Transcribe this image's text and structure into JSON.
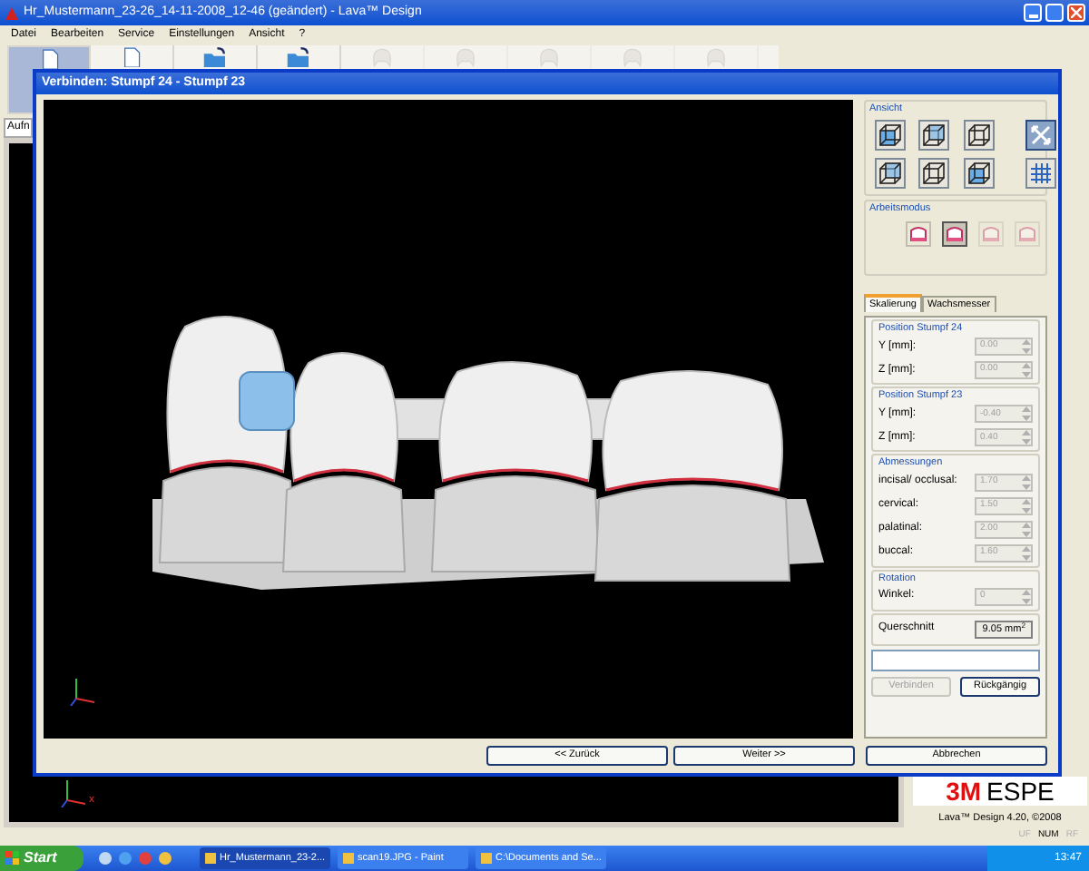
{
  "window": {
    "title": "Hr_Mustermann_23-26_14-11-2008_12-46 (geändert) - Lava™ Design"
  },
  "menu": [
    "Datei",
    "Bearbeiten",
    "Service",
    "Einstellungen",
    "Ansicht",
    "?"
  ],
  "toolbar": [
    {
      "selected": true,
      "disabled": false
    },
    {
      "selected": false,
      "disabled": false
    },
    {
      "selected": false,
      "disabled": false
    },
    {
      "selected": false,
      "disabled": false
    },
    {
      "selected": false,
      "disabled": true
    },
    {
      "selected": false,
      "disabled": true
    },
    {
      "selected": false,
      "disabled": true
    },
    {
      "selected": false,
      "disabled": true
    },
    {
      "selected": false,
      "disabled": true
    }
  ],
  "main_tab": "Aufn",
  "axis_label": "x",
  "brand": {
    "logo_left": "3M",
    "logo_right": "ESPE",
    "version": "Lava™ Design 4.20, ©2008"
  },
  "status_bar": [
    {
      "text": "UF",
      "active": false
    },
    {
      "text": "NUM",
      "active": true
    },
    {
      "text": "RF",
      "active": false
    }
  ],
  "dialog": {
    "title": "Verbinden: Stumpf 24 - Stumpf 23",
    "ansicht": {
      "title": "Ansicht",
      "tools": [
        {
          "selected": false
        },
        {
          "selected": false
        },
        {
          "selected": false
        },
        {
          "selected": true
        },
        {
          "selected": false
        },
        {
          "selected": false
        },
        {
          "selected": false
        },
        {
          "selected": false
        }
      ]
    },
    "arbeitsmodus": {
      "title": "Arbeitsmodus",
      "tools": [
        {
          "selected": false,
          "disabled": false
        },
        {
          "selected": true,
          "disabled": false
        },
        {
          "selected": false,
          "disabled": true
        },
        {
          "selected": false,
          "disabled": true
        }
      ]
    },
    "tabs": [
      {
        "label": "Skalierung",
        "selected": true
      },
      {
        "label": "Wachsmesser",
        "selected": false
      }
    ],
    "groups": [
      {
        "title": "Position Stumpf 24",
        "fields": [
          {
            "label": "Y [mm]:",
            "value": "0.00",
            "disabled": true
          },
          {
            "label": "Z [mm]:",
            "value": "0.00",
            "disabled": true
          }
        ]
      },
      {
        "title": "Position Stumpf 23",
        "fields": [
          {
            "label": "Y [mm]:",
            "value": "-0.40",
            "disabled": true
          },
          {
            "label": "Z [mm]:",
            "value": "0.40",
            "disabled": true
          }
        ]
      },
      {
        "title": "Abmessungen",
        "fields": [
          {
            "label": "incisal/ occlusal:",
            "value": "1.70",
            "disabled": true
          },
          {
            "label": "cervical:",
            "value": "1.50",
            "disabled": true
          },
          {
            "label": "palatinal:",
            "value": "2.00",
            "disabled": true
          },
          {
            "label": "buccal:",
            "value": "1.60",
            "disabled": true
          }
        ]
      },
      {
        "title": "Rotation",
        "fields": [
          {
            "label": "Winkel:",
            "value": "0",
            "disabled": true
          }
        ]
      }
    ],
    "querschnitt": {
      "label": "Querschnitt",
      "value": "9.05 mm$^{2}$"
    },
    "actions": [
      {
        "label": "Verbinden",
        "disabled": true
      },
      {
        "label": "Rückgängig",
        "disabled": false
      }
    ],
    "footer": [
      "<< Zurück",
      "Weiter >>",
      "Abbrechen"
    ]
  },
  "taskbar": {
    "start": "Start",
    "tasks": [
      {
        "label": "Hr_Mustermann_23-2...",
        "selected": true
      },
      {
        "label": "scan19.JPG - Paint",
        "selected": false
      },
      {
        "label": "C:\\Documents and Se...",
        "selected": false
      }
    ],
    "clock": "13:47"
  }
}
